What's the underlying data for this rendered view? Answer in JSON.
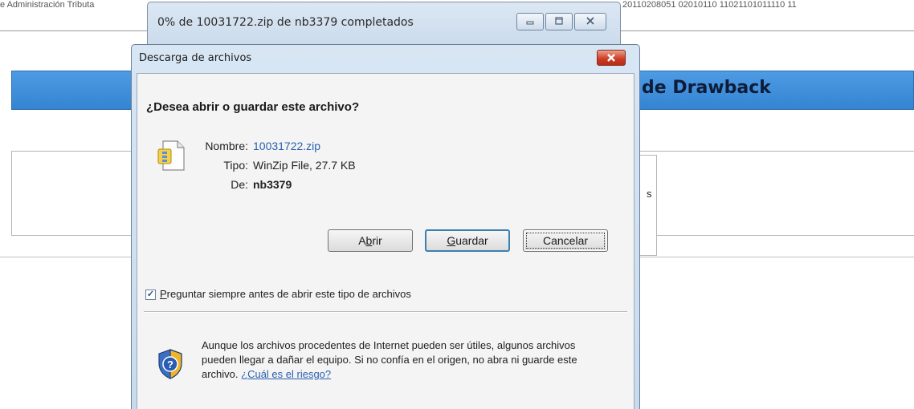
{
  "background_page": {
    "top_text_left": "e Administración Tributa",
    "top_text_right": "20110208051 02010110 11021101011110 11",
    "header_title": "de Drawback",
    "box_fragment": "s"
  },
  "progress_window": {
    "title": "0% de 10031722.zip de nb3379 completados",
    "controls": {
      "minimize_icon": "minimize-icon",
      "maximize_icon": "maximize-icon",
      "close_icon": "close-icon"
    }
  },
  "dialog": {
    "title": "Descarga de archivos",
    "question": "¿Desea abrir o guardar este archivo?",
    "fields": {
      "name_label": "Nombre:",
      "name_value": "10031722.zip",
      "type_label": "Tipo:",
      "type_value": "WinZip File, 27.7 KB",
      "from_label": "De:",
      "from_value": "nb3379"
    },
    "buttons": {
      "open_pre": "A",
      "open_key": "b",
      "open_post": "rir",
      "save_pre": "",
      "save_key": "G",
      "save_post": "uardar",
      "cancel": "Cancelar"
    },
    "checkbox": {
      "checked": true,
      "label_key": "P",
      "label_rest": "reguntar siempre antes de abrir este tipo de archivos"
    },
    "warning": {
      "text": "Aunque los archivos procedentes de Internet pueden ser útiles, algunos archivos pueden llegar a dañar el equipo. Si no confía en el origen, no abra ni guarde este archivo. ",
      "link": "¿Cuál es el riesgo?"
    },
    "icons": {
      "file": "zip-file-icon",
      "shield": "security-shield-icon",
      "close": "close-icon"
    },
    "colors": {
      "link": "#2b5fb0",
      "title_bar": "#c8dbee",
      "close_button": "#cc3a22",
      "page_banner": "#3584d1"
    }
  }
}
